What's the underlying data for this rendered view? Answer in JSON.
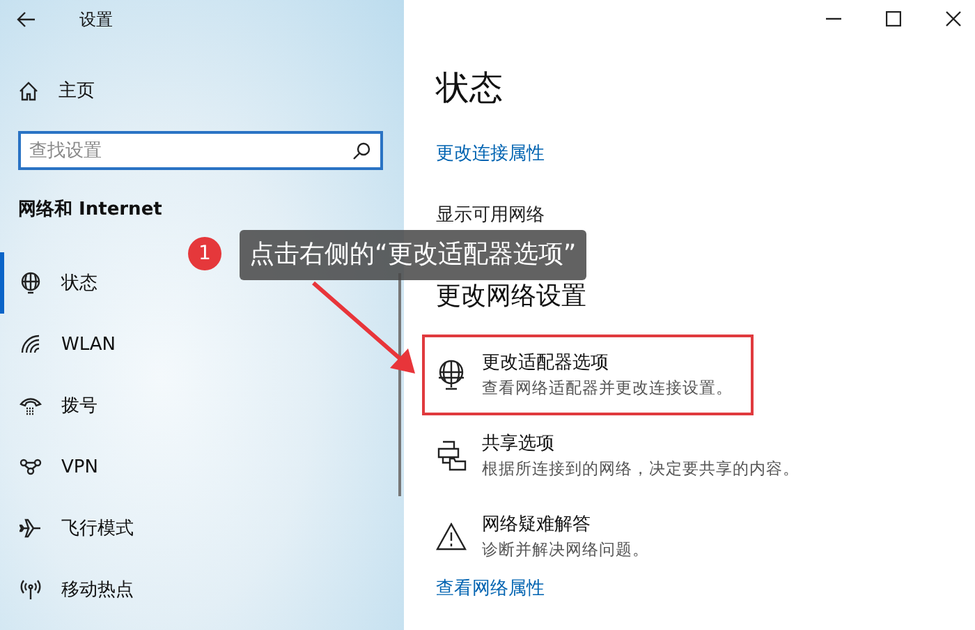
{
  "window": {
    "title": "设置"
  },
  "sidebar": {
    "home": "主页",
    "search": {
      "placeholder": "查找设置"
    },
    "section": "网络和 Internet",
    "items": [
      {
        "kind": "status",
        "label": "状态",
        "selected": true
      },
      {
        "kind": "wlan",
        "label": "WLAN",
        "selected": false
      },
      {
        "kind": "dialup",
        "label": "拨号",
        "selected": false
      },
      {
        "kind": "vpn",
        "label": "VPN",
        "selected": false
      },
      {
        "kind": "airplane",
        "label": "飞行模式",
        "selected": false
      },
      {
        "kind": "hotspot",
        "label": "移动热点",
        "selected": false
      }
    ]
  },
  "content": {
    "title": "状态",
    "links": [
      "更改连接属性",
      "显示可用网络"
    ],
    "section": "更改网络设置",
    "options": [
      {
        "kind": "adapter",
        "title": "更改适配器选项",
        "description": "查看网络适配器并更改连接设置。",
        "highlighted": true
      },
      {
        "kind": "sharing",
        "title": "共享选项",
        "description": "根据所连接到的网络，决定要共享的内容。",
        "highlighted": false
      },
      {
        "kind": "troubleshoot",
        "title": "网络疑难解答",
        "description": "诊断并解决网络问题。",
        "highlighted": false
      }
    ],
    "bottom_link": "查看网络属性"
  },
  "annotation": {
    "step": "1",
    "text": "点击右侧的“更改适配器选项”"
  }
}
